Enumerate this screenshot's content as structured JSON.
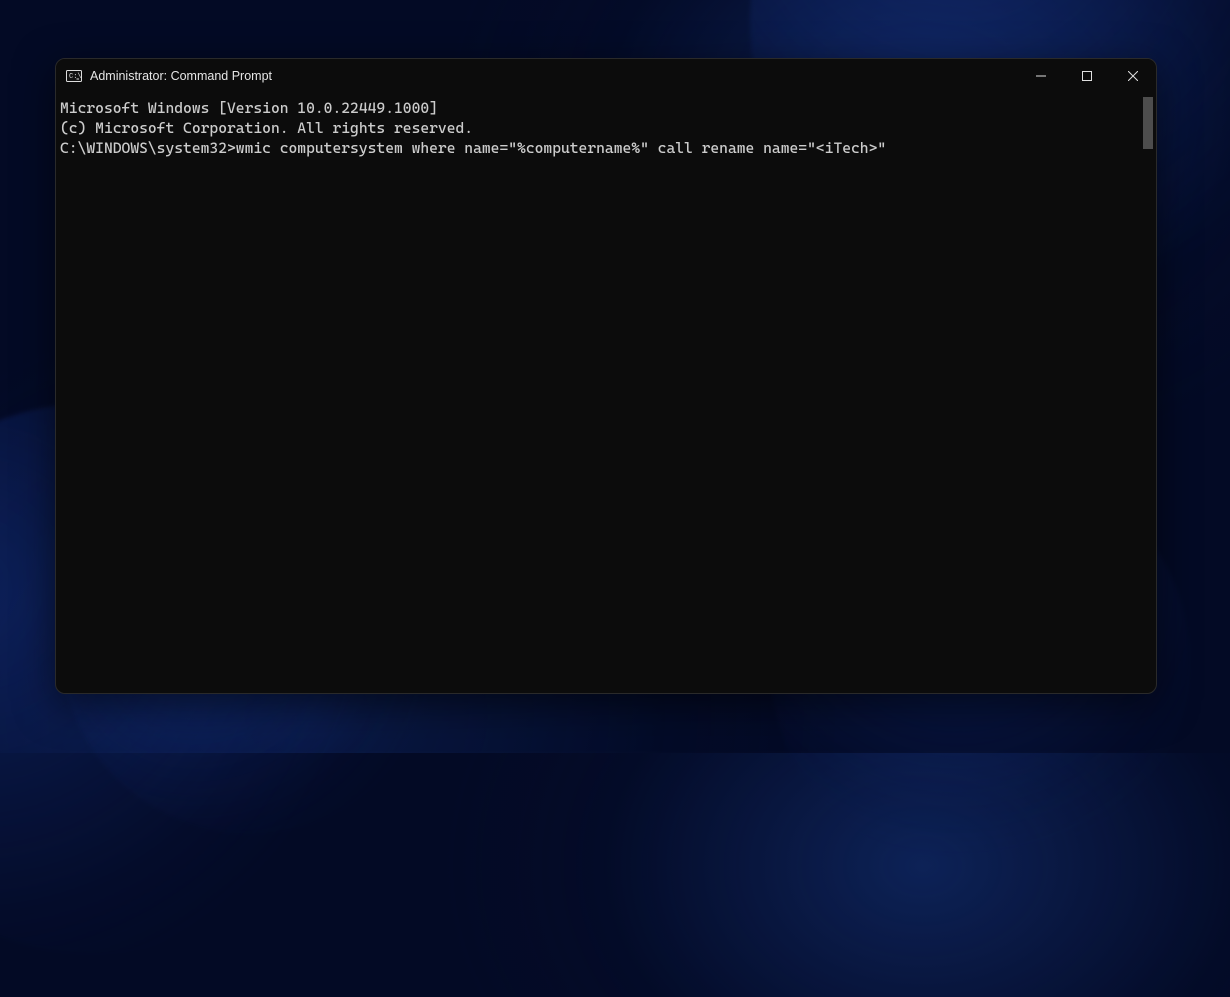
{
  "window": {
    "title": "Administrator: Command Prompt",
    "icon": "cmd-prompt-icon"
  },
  "terminal": {
    "banner_line1": "Microsoft Windows [Version 10.0.22449.1000]",
    "banner_line2": "(c) Microsoft Corporation. All rights reserved.",
    "blank_line": "",
    "prompt": "C:\\WINDOWS\\system32>",
    "command": "wmic computersystem where name=\"%computername%\" call rename name=\"<iTech>\""
  },
  "controls": {
    "minimize": "minimize",
    "maximize": "maximize",
    "close": "close"
  }
}
